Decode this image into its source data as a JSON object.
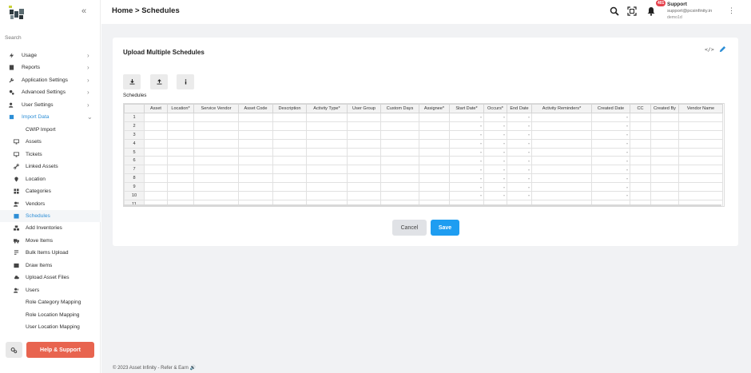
{
  "sidebar": {
    "search_placeholder": "Search",
    "items": [
      {
        "label": "Usage",
        "icon": "bolt-icon",
        "chevron": "›"
      },
      {
        "label": "Reports",
        "icon": "report-icon",
        "chevron": "›"
      },
      {
        "label": "Application Settings",
        "icon": "wrench-icon",
        "chevron": "›"
      },
      {
        "label": "Advanced Settings",
        "icon": "gears-icon",
        "chevron": "›"
      },
      {
        "label": "User Settings",
        "icon": "user-gear-icon",
        "chevron": "›"
      },
      {
        "label": "Import Data",
        "icon": "import-icon",
        "chevron": "⌄"
      },
      {
        "label": "CWIP Import",
        "icon": ""
      },
      {
        "label": "Assets",
        "icon": "monitor-icon"
      },
      {
        "label": "Tickets",
        "icon": "monitor-icon"
      },
      {
        "label": "Linked Assets",
        "icon": "link-icon"
      },
      {
        "label": "Location",
        "icon": "location-pin-icon"
      },
      {
        "label": "Categories",
        "icon": "grid-icon"
      },
      {
        "label": "Vendors",
        "icon": "vendor-icon"
      },
      {
        "label": "Schedules",
        "icon": "calendar-icon"
      },
      {
        "label": "Add Inventories",
        "icon": "boxes-icon"
      },
      {
        "label": "Move Items",
        "icon": "truck-icon"
      },
      {
        "label": "Bulk Items Upload",
        "icon": "upload-list-icon"
      },
      {
        "label": "Draw Items",
        "icon": "box-icon"
      },
      {
        "label": "Upload Asset Files",
        "icon": "upload-cloud-icon"
      },
      {
        "label": "Users",
        "icon": "users-icon"
      },
      {
        "label": "Role Category Mapping",
        "icon": ""
      },
      {
        "label": "Role Location Mapping",
        "icon": ""
      },
      {
        "label": "User Location Mapping",
        "icon": ""
      }
    ],
    "help_label": "Help & Support"
  },
  "header": {
    "breadcrumb": "Home > Schedules",
    "notification_count": "401",
    "user_name": "Support",
    "user_email": "support@pcsinfinity.in",
    "user_role": "demo1d"
  },
  "card": {
    "title": "Upload Multiple Schedules",
    "code_icon_text": "</>",
    "section_label": "Schedules",
    "columns": [
      "Asset",
      "Location*",
      "Service Vendor",
      "Asset Code",
      "Description",
      "Activity Type*",
      "User Group",
      "Custom Days",
      "Assignee*",
      "Start Date*",
      "Occurs*",
      "End Date",
      "Activity Reminders*",
      "Created Date",
      "CC",
      "Created By",
      "Vendor Name"
    ],
    "rows": [
      "1",
      "2",
      "3",
      "4",
      "5",
      "6",
      "7",
      "8",
      "9",
      "10",
      "11"
    ],
    "cancel_label": "Cancel",
    "save_label": "Save"
  },
  "footer": {
    "text": "© 2023  Asset Infinity - Refer & Earn 🔊"
  },
  "colors": {
    "accent": "#2d8ed6",
    "save": "#1e9df1",
    "help": "#e8644f",
    "badge": "#e5424d"
  }
}
